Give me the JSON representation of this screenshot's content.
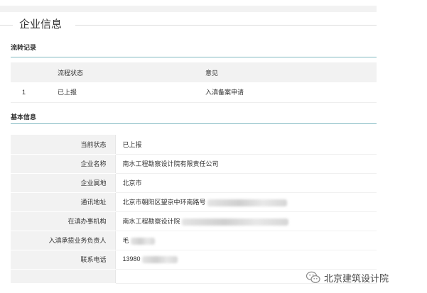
{
  "panel": {
    "title": "企业信息"
  },
  "flow_section": {
    "title": "流转记录",
    "columns": [
      "",
      "流程状态",
      "意见"
    ],
    "rows": [
      {
        "index": "1",
        "status": "已上报",
        "opinion": "入滇备案申请"
      }
    ]
  },
  "basic_section": {
    "title": "基本信息",
    "fields": [
      {
        "label": "当前状态",
        "value": "已上报"
      },
      {
        "label": "企业名称",
        "value": "南水工程勘察设计院有限责任公司"
      },
      {
        "label": "企业属地",
        "value": "北京市"
      },
      {
        "label": "通讯地址",
        "value": "北京市朝阳区望京中环南路号"
      },
      {
        "label": "在滇办事机构",
        "value": "南水工程勘察设计院"
      },
      {
        "label": "入滇承揽业务负责人",
        "value": "毛"
      },
      {
        "label": "联系电话",
        "value": "13980"
      },
      {
        "label": "",
        "value": ""
      }
    ]
  },
  "watermark": {
    "text": "北京建筑设计院",
    "icon": "wechat-icon"
  }
}
